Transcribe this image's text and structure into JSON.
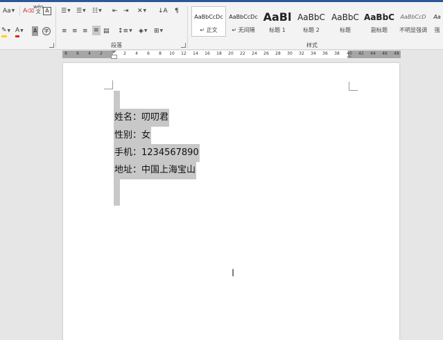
{
  "ribbon": {
    "font": {
      "change_case": "Aa",
      "phonetic": "wén",
      "char_border": "A",
      "font_color": "A",
      "char_shading": "A",
      "enclose": "字"
    },
    "paragraph": {
      "label": "段落"
    },
    "styles": {
      "label": "样式",
      "items": [
        {
          "preview": "AaBbCcDc",
          "name": "↵ 正文"
        },
        {
          "preview": "AaBbCcDc",
          "name": "↵ 无间隔"
        },
        {
          "preview": "AaBl",
          "name": "标题 1"
        },
        {
          "preview": "AaBbC",
          "name": "标题 2"
        },
        {
          "preview": "AaBbC",
          "name": "标题"
        },
        {
          "preview": "AaBbC",
          "name": "副标题"
        },
        {
          "preview": "AaBbCcD",
          "name": "不明显强调"
        },
        {
          "preview": "Aa",
          "name": "强"
        }
      ]
    }
  },
  "ruler": {
    "left_ticks": [
      "8",
      "6",
      "4",
      "2"
    ],
    "ticks": [
      "2",
      "4",
      "6",
      "8",
      "10",
      "12",
      "14",
      "16",
      "18",
      "20",
      "22",
      "24",
      "26",
      "28",
      "30",
      "32",
      "34",
      "36",
      "38",
      "40",
      "42",
      "44",
      "46",
      "48"
    ]
  },
  "document": {
    "lines": [
      "姓名：叨叨君",
      "性别：女",
      "手机：1234567890",
      "地址：中国上海宝山"
    ]
  },
  "colors": {
    "title_bar": "#2b579a",
    "selection": "#c8c8c8",
    "font_color_red": "#e02020",
    "highlight_yellow": "#ffd400"
  }
}
